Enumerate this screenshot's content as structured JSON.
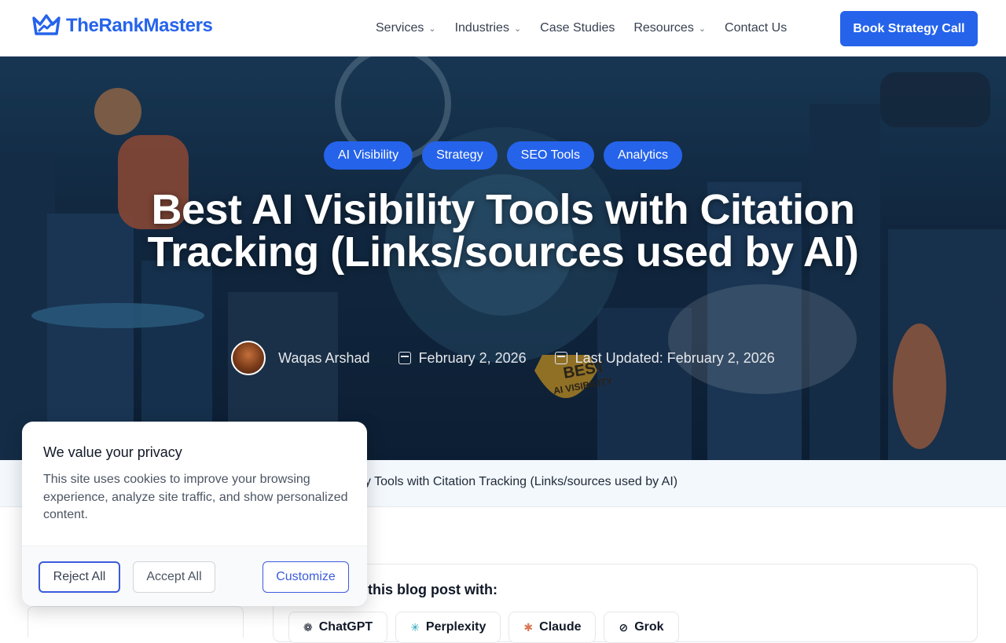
{
  "brand": {
    "name": "TheRankMasters",
    "color": "#2563eb"
  },
  "nav": {
    "items": [
      {
        "label": "Services",
        "dropdown": true
      },
      {
        "label": "Industries",
        "dropdown": true
      },
      {
        "label": "Case Studies",
        "dropdown": false
      },
      {
        "label": "Resources",
        "dropdown": true
      },
      {
        "label": "Contact Us",
        "dropdown": false
      }
    ],
    "cta": "Book Strategy Call"
  },
  "hero": {
    "tags": [
      "AI Visibility",
      "Strategy",
      "SEO Tools",
      "Analytics"
    ],
    "title": "Best AI Visibility Tools with Citation Tracking (Links/sources used by AI)",
    "author": "Waqas Arshad",
    "published": "February 2, 2026",
    "updated": "Last Updated: February 2, 2026",
    "illustration_text": [
      "BEST",
      "AI VISIBILITY"
    ]
  },
  "breadcrumb": {
    "current": "y Tools with Citation Tracking (Links/sources used by AI)"
  },
  "summary": {
    "label": "this blog post with:",
    "tools": [
      {
        "name": "ChatGPT",
        "icon": "chatgpt-icon"
      },
      {
        "name": "Perplexity",
        "icon": "perplexity-icon"
      },
      {
        "name": "Claude",
        "icon": "claude-icon"
      },
      {
        "name": "Grok",
        "icon": "grok-icon"
      }
    ]
  },
  "cookie": {
    "title": "We value your privacy",
    "body": "This site uses cookies to improve your browsing experience, analyze site traffic, and show personalized content.",
    "reject": "Reject All",
    "accept": "Accept All",
    "customize": "Customize"
  }
}
